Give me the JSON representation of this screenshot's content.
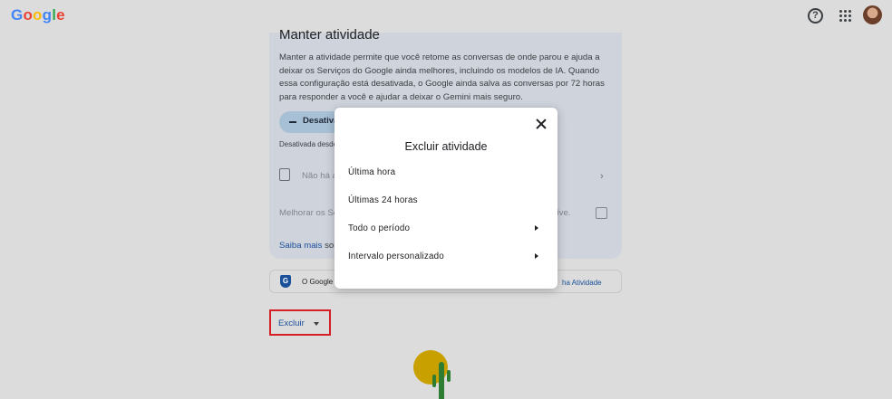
{
  "header": {
    "logo_letters": [
      {
        "ch": "G",
        "color": "#4285f4"
      },
      {
        "ch": "o",
        "color": "#ea4335"
      },
      {
        "ch": "o",
        "color": "#fbbc05"
      },
      {
        "ch": "g",
        "color": "#4285f4"
      },
      {
        "ch": "l",
        "color": "#34a853"
      },
      {
        "ch": "e",
        "color": "#ea4335"
      }
    ],
    "help_glyph": "?",
    "icons": [
      "help-icon",
      "apps-grid-icon",
      "account-avatar"
    ]
  },
  "card": {
    "title": "Manter atividade",
    "text": "Manter a atividade permite que você retome as conversas de onde parou e ajuda a deixar os Serviços do Google ainda melhores, incluindo os modelos de IA. Quando essa configuração está desativada, o Google ainda salva as conversas por 72 horas para responder a você e ajudar a deixar o Gemini mais seguro.",
    "toggle_label": "Desativa",
    "since_text": "Desativada desde",
    "history_text": "Não há a",
    "improve_text": "Melhorar os Se",
    "improve_tail": "íve.",
    "learn_more_link": "Saiba mais",
    "learn_more_tail": " sob"
  },
  "info_box": {
    "shield_glyph": "G",
    "text": "O Google",
    "link": "ha Atividade"
  },
  "delete_button": {
    "label": "Excluir"
  },
  "dialog": {
    "title": "Excluir atividade",
    "options": [
      {
        "label": "Última hora",
        "has_submenu": false
      },
      {
        "label": "Últimas 24 horas",
        "has_submenu": false
      },
      {
        "label": "Todo o período",
        "has_submenu": true
      },
      {
        "label": "Intervalo personalizado",
        "has_submenu": true
      }
    ]
  },
  "colors": {
    "accent_blue": "#1a4f9a",
    "highlight_red": "#d41f26",
    "overlay_bg": "#dcdcdc"
  }
}
